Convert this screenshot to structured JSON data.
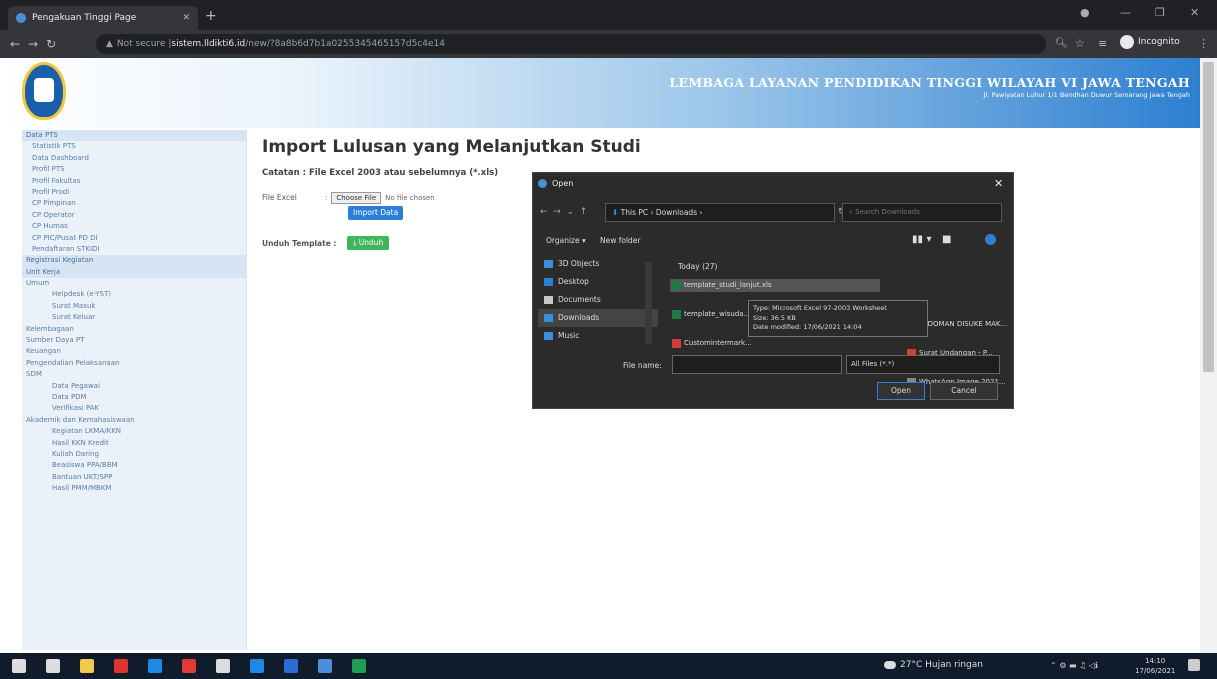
{
  "browser": {
    "tab_title": "Pengakuan Tinggi Page",
    "url_prefix": "Not secure | ",
    "url_host": "sistem.lldikti6.id",
    "url_path": "/new/?8a8b6d7b1a0255345465157d5c4e14",
    "incognito_label": "Incognito"
  },
  "header": {
    "title": "LEMBAGA LAYANAN PENDIDIKAN TINGGI WILAYAH VI JAWA TENGAH",
    "subtitle": "Jl. Pawiyatan Luhur 1/1 Bendhan Duwur Semarang Jawa Tengah"
  },
  "sidebar": {
    "items": [
      {
        "label": "Data PTS",
        "level": "l1",
        "section": true
      },
      {
        "label": "Statistik PTS",
        "level": "l2"
      },
      {
        "label": "Data Dashboard",
        "level": "l2"
      },
      {
        "label": "Profil PTS",
        "level": "l2"
      },
      {
        "label": "Profil Fakultas",
        "level": "l2"
      },
      {
        "label": "Profil Prodi",
        "level": "l2"
      },
      {
        "label": "CP Pimpinan",
        "level": "l2"
      },
      {
        "label": "CP Operator",
        "level": "l2"
      },
      {
        "label": "CP Humas",
        "level": "l2"
      },
      {
        "label": "CP PIC/Pusat PD DI",
        "level": "l2"
      },
      {
        "label": "Pendaftaran STKIDI",
        "level": "l2"
      },
      {
        "label": "Registrasi Kegiatan",
        "level": "l1",
        "section": true
      },
      {
        "label": "Unit Kerja",
        "level": "l1",
        "section": true
      },
      {
        "label": "Umum",
        "level": "l1"
      },
      {
        "label": "Helpdesk (e-YST)",
        "level": "l3"
      },
      {
        "label": "Surat Masuk",
        "level": "l3"
      },
      {
        "label": "Surat Keluar",
        "level": "l3"
      },
      {
        "label": "Kelembagaan",
        "level": "l1"
      },
      {
        "label": "Sumber Daya PT",
        "level": "l1"
      },
      {
        "label": "Keuangan",
        "level": "l1"
      },
      {
        "label": "Pengendalian Pelaksanaan",
        "level": "l1"
      },
      {
        "label": "SDM",
        "level": "l1"
      },
      {
        "label": "Data Pegawai",
        "level": "l3"
      },
      {
        "label": "Data PDM",
        "level": "l3"
      },
      {
        "label": "Verifikasi PAK",
        "level": "l3"
      },
      {
        "label": "Akademik dan Kemahasiswaan",
        "level": "l1"
      },
      {
        "label": "Kegiatan LKMA/KKN",
        "level": "l3"
      },
      {
        "label": "Hasil KKN Kredit",
        "level": "l3"
      },
      {
        "label": "Kuliah Daring",
        "level": "l3"
      },
      {
        "label": "Beasiswa PPA/BBM",
        "level": "l3"
      },
      {
        "label": "Bantuan UKT/SPP",
        "level": "l3"
      },
      {
        "label": "Hasil PMM/MBKM",
        "level": "l3"
      }
    ]
  },
  "main": {
    "title": "Import Lulusan yang Melanjutkan Studi",
    "note": "Catatan : File Excel 2003 atau sebelumnya (*.xls)",
    "file_label": "File Excel",
    "choose_file": "Choose File",
    "no_file": "No file chosen",
    "import_button": "Import Data",
    "template_label": "Unduh Template :",
    "download_button": "Unduh"
  },
  "dialog": {
    "title": "Open",
    "path": "This PC  ›  Downloads  ›",
    "search_placeholder": "Search Downloads",
    "organize": "Organize ▾",
    "new_folder": "New folder",
    "nav_items": [
      {
        "label": "3D Objects",
        "color": "#3d8ed8"
      },
      {
        "label": "Desktop",
        "color": "#2f7fd1"
      },
      {
        "label": "Documents",
        "color": "#c8c8c8"
      },
      {
        "label": "Downloads",
        "color": "#3a8de0",
        "selected": true
      },
      {
        "label": "Music",
        "color": "#3a8de0"
      }
    ],
    "group_header": "Today (27)",
    "files": [
      {
        "name": "template_studi_lanjut.xls",
        "icon": "excel-icon",
        "color": "#1f7a45"
      },
      {
        "name": "template_wisuda...",
        "icon": "excel-icon",
        "color": "#1f7a45"
      },
      {
        "name": "Customintermark...",
        "icon": "pdf-icon",
        "color": "#d53b3b"
      },
      {
        "name": "PEDOMAN DISUKE MAK...",
        "icon": "pdf-icon",
        "color": "#d53b3b"
      },
      {
        "name": "Surat Undangan - P...",
        "icon": "pdf-icon",
        "color": "#d53b3b"
      },
      {
        "name": "WhatsApp Image 2021...",
        "icon": "image-icon",
        "color": "#888"
      }
    ],
    "tooltip": [
      "Type: Microsoft Excel 97-2003 Worksheet",
      "Size: 36.5 KB",
      "Date modified: 17/06/2021 14:04"
    ],
    "filename_label": "File name:",
    "filetype": "All Files (*.*)",
    "open_button": "Open",
    "cancel_button": "Cancel"
  },
  "taskbar": {
    "weather": "27°C  Hujan ringan",
    "time": "14:10",
    "date": "17/06/2021",
    "apps": [
      "start",
      "search",
      "explorer",
      "office",
      "chrome",
      "opera",
      "file",
      "store",
      "word",
      "photos",
      "excel"
    ]
  }
}
